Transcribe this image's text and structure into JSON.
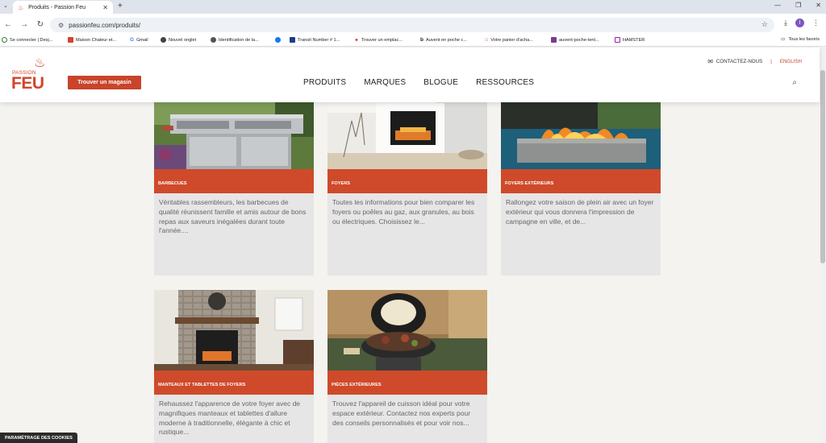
{
  "browser": {
    "tab_title": "Produits - Passion Feu",
    "url": "passionfeu.com/produits/",
    "profile_initial": "I",
    "bookmarks": [
      {
        "label": "Se connecter | Desj..."
      },
      {
        "label": "Maison Chaleur et..."
      },
      {
        "label": "Gmail"
      },
      {
        "label": "Nouvel onglet"
      },
      {
        "label": "Identification de la..."
      },
      {
        "label": ""
      },
      {
        "label": "Transit Number # 1..."
      },
      {
        "label": "Trouver un emplac..."
      },
      {
        "label": "Auvent en poche c..."
      },
      {
        "label": "Votre panier d'acha..."
      },
      {
        "label": "auvent-poche-tent..."
      },
      {
        "label": "HAMSTER"
      }
    ],
    "all_favorites": "Tous les favoris"
  },
  "site": {
    "logo_top": "PASSION",
    "logo_main": "FEU",
    "store_button": "Trouver un magasin",
    "nav": [
      "PRODUITS",
      "MARQUES",
      "BLOGUE",
      "RESSOURCES"
    ],
    "contact": "CONTACTEZ-NOUS",
    "language": "ENGLISH",
    "accent_color": "#cf4a2a"
  },
  "cards": [
    {
      "category": "BARBECUES",
      "description": "Véritables rassembleurs, les barbecues de qualité réunissent famille et amis autour de bons repas aux saveurs inégalées durant toute l'année....",
      "image": "barbecue-grills"
    },
    {
      "category": "FOYERS",
      "description": "Toutes les informations pour bien comparer les foyers ou poêles au gaz, aux granules, au bois ou électriques. Choisissez le...",
      "image": "indoor-fireplace"
    },
    {
      "category": "FOYERS EXTÉRIEURS",
      "description": "Rallongez votre saison de plein air avec un foyer extérieur qui vous donnera l'impression de campagne en ville, et de...",
      "image": "outdoor-fire-table"
    },
    {
      "category": "MANTEAUX ET TABLETTES DE FOYERS",
      "description": "Rehaussez l'apparence de votre foyer avec de magnifiques manteaux et tablettes d'allure moderne à traditionnelle, élégante à chic et rustique...",
      "image": "stone-fireplace-mantel"
    },
    {
      "category": "PIÈCES EXTÉRIEURES",
      "description": "Trouvez l'appareil de cuisson idéal pour votre espace extérieur. Contactez nos experts pour des conseils personnalisés et pour voir nos...",
      "image": "kamado-grill"
    }
  ],
  "cookie_settings": "PARAMÉTRAGE DES COOKIES"
}
